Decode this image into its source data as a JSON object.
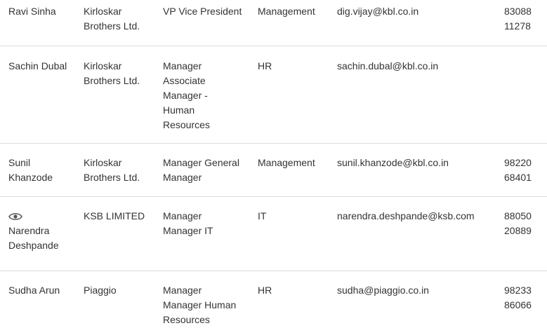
{
  "rows": [
    {
      "name": "Ravi Sinha",
      "company": [
        "Kirloskar",
        "Brothers Ltd."
      ],
      "title": [
        "VP Vice President"
      ],
      "department": "Management",
      "email": "dig.vijay@kbl.co.in",
      "phone": [
        "83088",
        "11278"
      ],
      "has_view_icon": false
    },
    {
      "name": "Sachin Dubal",
      "company": [
        "Kirloskar",
        "Brothers Ltd."
      ],
      "title": [
        "Manager",
        "Associate",
        "Manager -",
        "Human",
        "Resources"
      ],
      "department": "HR",
      "email": "sachin.dubal@kbl.co.in",
      "phone": [],
      "has_view_icon": false
    },
    {
      "name": "Sunil Khanzode",
      "company": [
        "Kirloskar",
        "Brothers Ltd."
      ],
      "title": [
        "Manager General",
        "Manager"
      ],
      "department": "Management",
      "email": "sunil.khanzode@kbl.co.in",
      "phone": [
        "98220",
        "68401"
      ],
      "has_view_icon": false
    },
    {
      "name": "Narendra Deshpande",
      "company": [
        "KSB LIMITED"
      ],
      "title": [
        "Manager",
        "Manager IT"
      ],
      "department": "IT",
      "email": "narendra.deshpande@ksb.com",
      "phone": [
        "88050",
        "20889"
      ],
      "has_view_icon": true
    },
    {
      "name": "Sudha Arun",
      "company": [
        "Piaggio"
      ],
      "title": [
        "Manager",
        "Manager Human",
        "Resources"
      ],
      "department": "HR",
      "email": "sudha@piaggio.co.in",
      "phone": [
        "98233",
        "86066"
      ],
      "has_view_icon": false
    }
  ],
  "colors": {
    "text": "#333333",
    "divider": "#dcdcdc",
    "icon": "#555555"
  }
}
